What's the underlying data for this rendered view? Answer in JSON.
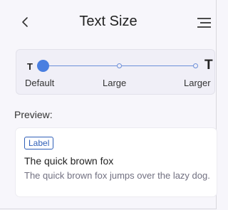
{
  "header": {
    "title": "Text Size",
    "back_icon": "chevron-left-icon",
    "menu_icon": "menu-icon"
  },
  "slider": {
    "min_glyph": "T",
    "max_glyph": "T",
    "stops": [
      "Default",
      "Large",
      "Larger"
    ],
    "selected_index": 0,
    "accent": "#4a7fe0"
  },
  "preview": {
    "label": "Preview:",
    "chip_label": "Label",
    "heading": "The quick brown fox",
    "body": "The quick brown fox jumps over the lazy dog."
  }
}
